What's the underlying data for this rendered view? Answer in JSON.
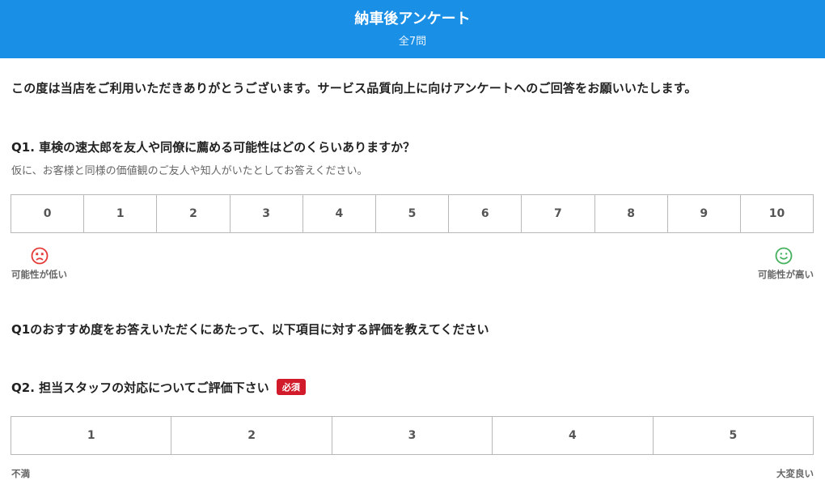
{
  "header": {
    "title": "納車後アンケート",
    "subtitle": "全7問"
  },
  "intro": "この度は当店をご利用いただきありがとうございます。サービス品質向上に向けアンケートへのご回答をお願いいたします。",
  "q1": {
    "title": "Q1. 車検の速太郎を友人や同僚に薦める可能性はどのくらいありますか？",
    "description": "仮に、お客様と同様の価値観のご友人や知人がいたとしてお答えください。",
    "options": [
      "0",
      "1",
      "2",
      "3",
      "4",
      "5",
      "6",
      "7",
      "8",
      "9",
      "10"
    ],
    "low_label": "可能性が低い",
    "high_label": "可能性が高い",
    "low_icon": "sad-face-icon",
    "high_icon": "smile-face-icon",
    "low_color": "#e53935",
    "high_color": "#43b05c"
  },
  "section_note": "Q1のおすすめ度をお答えいただくにあたって、以下項目に対する評価を教えてください",
  "q2": {
    "title": "Q2. 担当スタッフの対応についてご評価下さい",
    "required_badge": "必須",
    "options": [
      "1",
      "2",
      "3",
      "4",
      "5"
    ],
    "low_label": "不満",
    "high_label": "大変良い",
    "required_color": "#d11a2a"
  }
}
